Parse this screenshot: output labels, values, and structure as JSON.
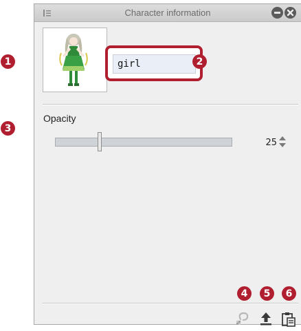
{
  "panel": {
    "title": "Character information",
    "icons": {
      "menu": "panel-menu-icon",
      "minimize": "minimize-icon",
      "close": "close-icon"
    }
  },
  "character": {
    "name": "girl",
    "thumbnail": "character-thumbnail"
  },
  "opacity": {
    "label": "Opacity",
    "value": "25",
    "fraction": 0.25
  },
  "toolbar": {
    "buttons": [
      {
        "name": "reset-icon",
        "enabled": false
      },
      {
        "name": "upload-icon",
        "enabled": true
      },
      {
        "name": "paste-clipboard-icon",
        "enabled": true
      }
    ]
  },
  "callouts": [
    "1",
    "2",
    "3",
    "4",
    "5",
    "6"
  ],
  "colors": {
    "callout": "#b01f2f",
    "titlebar": "#d4d4d4",
    "panel": "#efefef"
  }
}
